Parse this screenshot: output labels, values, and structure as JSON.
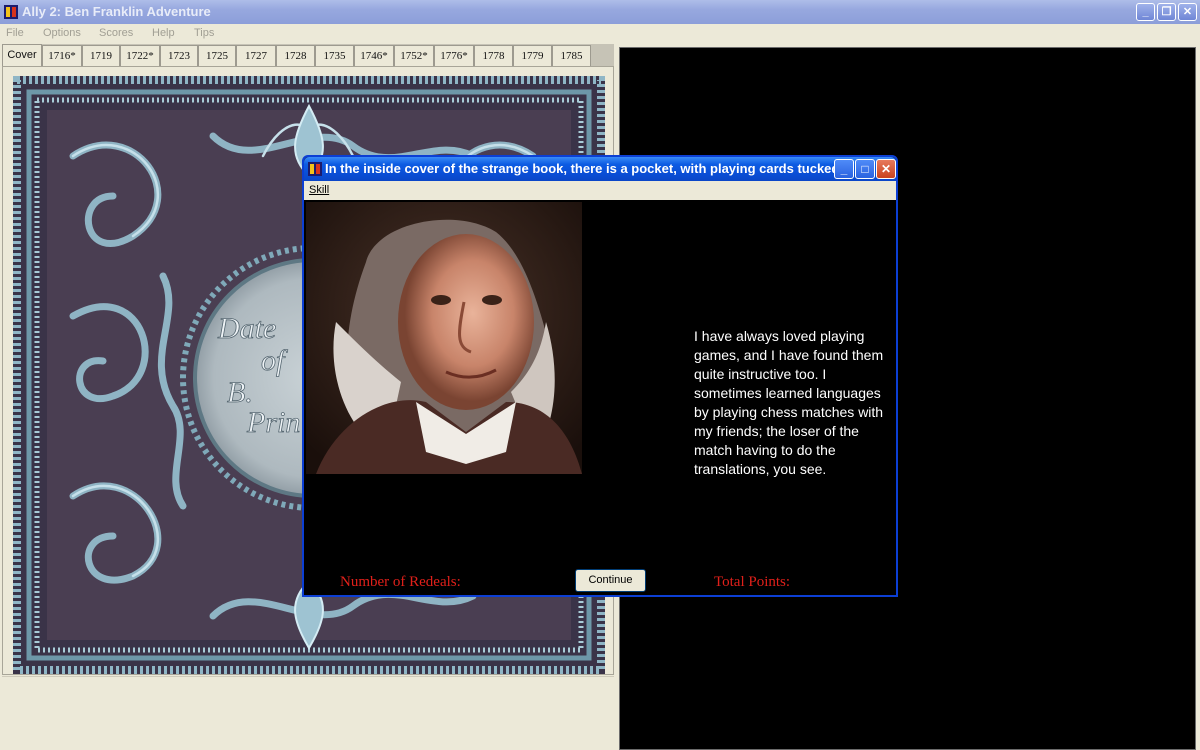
{
  "window": {
    "title": "Ally 2: Ben Franklin Adventure",
    "minimize": "_",
    "restore": "❐",
    "close": "✕"
  },
  "menu": [
    "File",
    "Options",
    "Scores",
    "Help",
    "Tips"
  ],
  "tabs": [
    "Cover",
    "1716*",
    "1719",
    "1722*",
    "1723",
    "1725",
    "1727",
    "1728",
    "1735",
    "1746*",
    "1752*",
    "1776*",
    "1778",
    "1779",
    "1785"
  ],
  "cover_text": [
    "Date",
    "of",
    "B.",
    "Prin"
  ],
  "dialog": {
    "title": "In the inside cover of the strange book, there is a pocket, with playing cards tucked ...",
    "menu_skill": "Skill",
    "quote": "I have always loved playing games, and I have found them quite instructive too.  I sometimes learned languages by playing chess matches with my friends; the loser of the match having to do the translations, you see.",
    "redeals_label": "Number of Redeals:",
    "points_label": "Total Points:",
    "continue_label": "Continue"
  },
  "colors": {
    "label_red": "#e0201a",
    "title_blue": "#0a4ed6"
  }
}
